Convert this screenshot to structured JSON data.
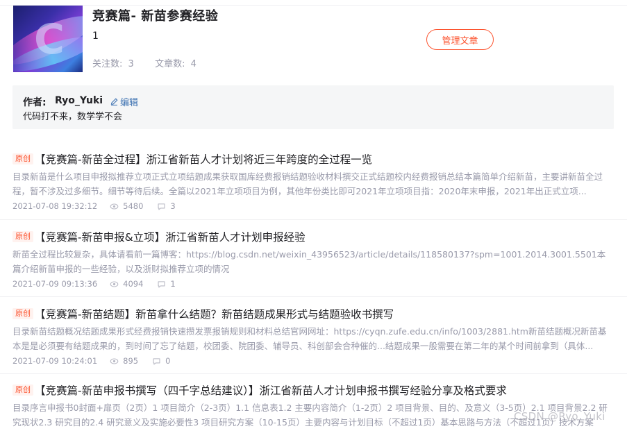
{
  "column": {
    "title": "竞赛篇- 新苗参赛经验",
    "description": "1",
    "followers_label": "关注数:",
    "followers_count": "3",
    "articles_label": "文章数:",
    "articles_count": "4",
    "manage_button": "管理文章",
    "cover_letter": "C"
  },
  "author": {
    "label": "作者:",
    "name": "Ryo_Yuki",
    "edit_label": "编辑",
    "intro": "代码打不来，数学学不会"
  },
  "articles": [
    {
      "badge": "原创",
      "title": "【竞赛篇-新苗全过程】浙江省新苗人才计划将近三年跨度的全过程一览",
      "summary": "目录新苗是什么项目申报拟推荐立项正式立项结题成果获取国库经费报销结题验收材料撰交正式结题校内经费报销总结本篇简单介绍新苗，主要讲新苗全过程，暂不涉及过多细节。细节等待后续。全篇以2021年立项项目为例，其他年份类比即可2021年立项项目指：2020年末申报，2021年出正式立项...",
      "date": "2021-07-08 19:32:12",
      "views": "5480",
      "comments": "3"
    },
    {
      "badge": "原创",
      "title": "【竞赛篇-新苗申报&立项】浙江省新苗人才计划申报经验",
      "summary": "新苗全过程比较复杂，具体请看前一篇博客：https://blog.csdn.net/weixin_43956523/article/details/118580137?spm=1001.2014.3001.5501本篇介绍新苗申报的一些经验，以及浙财拟推荐立项的情况",
      "date": "2021-07-09 09:13:36",
      "views": "4094",
      "comments": "1"
    },
    {
      "badge": "原创",
      "title": "【竞赛篇-新苗结题】新苗拿什么结题？新苗结题成果形式与结题验收书撰写",
      "summary": "目录新苗结题概况结题成果形式经费报销快速攒发票报销规则和材料总结官网网址：https://cyqn.zufe.edu.cn/info/1003/2881.htm新苗结题概况新苗基本是是必须要有结题成果的，到时间了忘了结题，校团委、院团委、辅导员、科创部会合种催的...结题成果一般需要在第二年的某个时间前拿到（具体...",
      "date": "2021-07-09 10:24:01",
      "views": "895",
      "comments": "0"
    },
    {
      "badge": "原创",
      "title": "【竞赛篇-新苗申报书撰写（四千字总结建议）】浙江省新苗人才计划申报书撰写经验分享及格式要求",
      "summary": "目录序言申报书0封面+扉页（2页）1 项目简介（2-3页）1.1 信息表1.2 主要内容简介（1-2页）2 项目背景、目的、及意义（3-5页）2.1 项目背景2.2 研究现状2.3 研究目的2.4 研究意义及实施必要性3 项目研究方案（10-15页）主要内容与计划目标（不超过1页）基本思路与方法（不超过1页）技术方案",
      "date": "",
      "views": "",
      "comments": ""
    }
  ],
  "watermark": "CSDN @Ryo_Yuki",
  "colors": {
    "accent": "#fc5531",
    "text": "#222226",
    "muted": "#999aaa",
    "link": "#3a6fb0",
    "panel": "#f5f6f7"
  },
  "icons": {
    "views": "eye-icon",
    "comments": "comment-icon",
    "edit": "pencil-icon"
  }
}
